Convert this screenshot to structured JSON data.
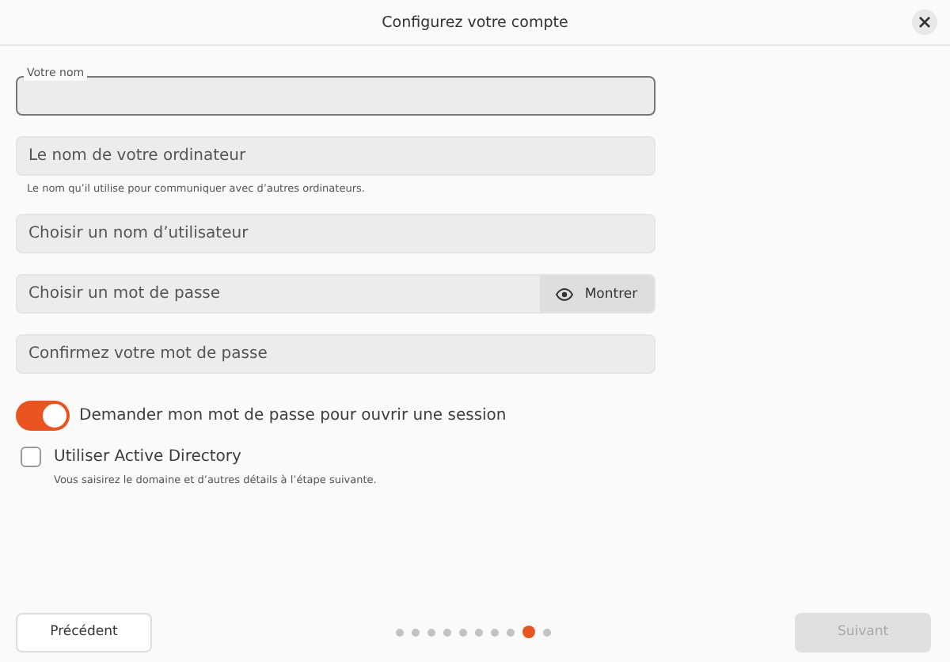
{
  "window": {
    "title": "Configurez votre compte"
  },
  "fields": [
    {
      "kind": "floating",
      "label": "Votre nom",
      "focused": true
    },
    {
      "kind": "plain",
      "placeholder": "Le nom de votre ordinateur",
      "hint": "Le nom qu’il utilise pour communiquer avec d’autres ordinateurs."
    },
    {
      "kind": "plain",
      "placeholder": "Choisir un nom d’utilisateur"
    },
    {
      "kind": "password",
      "placeholder": "Choisir un mot de passe",
      "reveal_label": "Montrer"
    },
    {
      "kind": "plain",
      "placeholder": "Confirmez votre mot de passe"
    }
  ],
  "require_password": {
    "label": "Demander mon mot de passe pour ouvrir une session",
    "on": true
  },
  "active_directory": {
    "label": "Utiliser Active Directory",
    "checked": false,
    "hint": "Vous saisirez le domaine et d’autres détails à l’étape suivante."
  },
  "footer": {
    "back": "Précédent",
    "next": {
      "label": "Suivant",
      "disabled": true
    },
    "steps": [
      {
        "selected": false
      },
      {
        "selected": false
      },
      {
        "selected": false
      },
      {
        "selected": false
      },
      {
        "selected": false
      },
      {
        "selected": false
      },
      {
        "selected": false
      },
      {
        "selected": false
      },
      {
        "selected": true
      },
      {
        "selected": false
      }
    ]
  }
}
